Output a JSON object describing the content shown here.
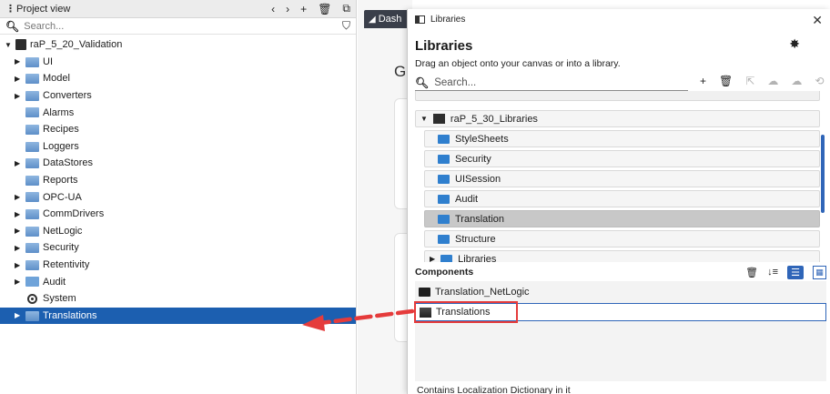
{
  "project_view": {
    "title": "Project view",
    "search_placeholder": "Search...",
    "toolbar_icons": [
      "chevron-left-icon",
      "chevron-right-icon",
      "plus-icon",
      "trash-icon",
      "copy-icon"
    ],
    "root": "raP_5_20_Validation",
    "items": [
      {
        "label": "UI",
        "expandable": true
      },
      {
        "label": "Model",
        "expandable": true
      },
      {
        "label": "Converters",
        "expandable": true
      },
      {
        "label": "Alarms",
        "expandable": false
      },
      {
        "label": "Recipes",
        "expandable": false
      },
      {
        "label": "Loggers",
        "expandable": false
      },
      {
        "label": "DataStores",
        "expandable": true
      },
      {
        "label": "Reports",
        "expandable": false
      },
      {
        "label": "OPC-UA",
        "expandable": true
      },
      {
        "label": "CommDrivers",
        "expandable": true
      },
      {
        "label": "NetLogic",
        "expandable": true
      },
      {
        "label": "Security",
        "expandable": true
      },
      {
        "label": "Retentivity",
        "expandable": true
      },
      {
        "label": "Audit",
        "expandable": true
      },
      {
        "label": "System",
        "expandable": false
      },
      {
        "label": "Translations",
        "expandable": true,
        "selected": true
      }
    ]
  },
  "editor": {
    "tab_label": "Dash",
    "heading_fragment": "G"
  },
  "libraries_dialog": {
    "window_title": "Libraries",
    "heading": "Libraries",
    "subtitle": "Drag an object onto your canvas or into a library.",
    "search_placeholder": "Search...",
    "library_root": "raP_5_30_Libraries",
    "library_items": [
      {
        "label": "StyleSheets"
      },
      {
        "label": "Security"
      },
      {
        "label": "UISession"
      },
      {
        "label": "Audit"
      },
      {
        "label": "Translation",
        "selected": true
      },
      {
        "label": "Structure"
      },
      {
        "label": "Libraries",
        "expandable": true
      }
    ],
    "components_header": "Components",
    "components": [
      {
        "label": "Translation_NetLogic"
      },
      {
        "label": "Translations",
        "selected": true
      }
    ],
    "description": "Contains Localization Dictionary in it"
  },
  "colors": {
    "selection_blue": "#1c5fb0",
    "highlight_red": "#e53b3b",
    "accent_blue": "#2f65b8"
  }
}
